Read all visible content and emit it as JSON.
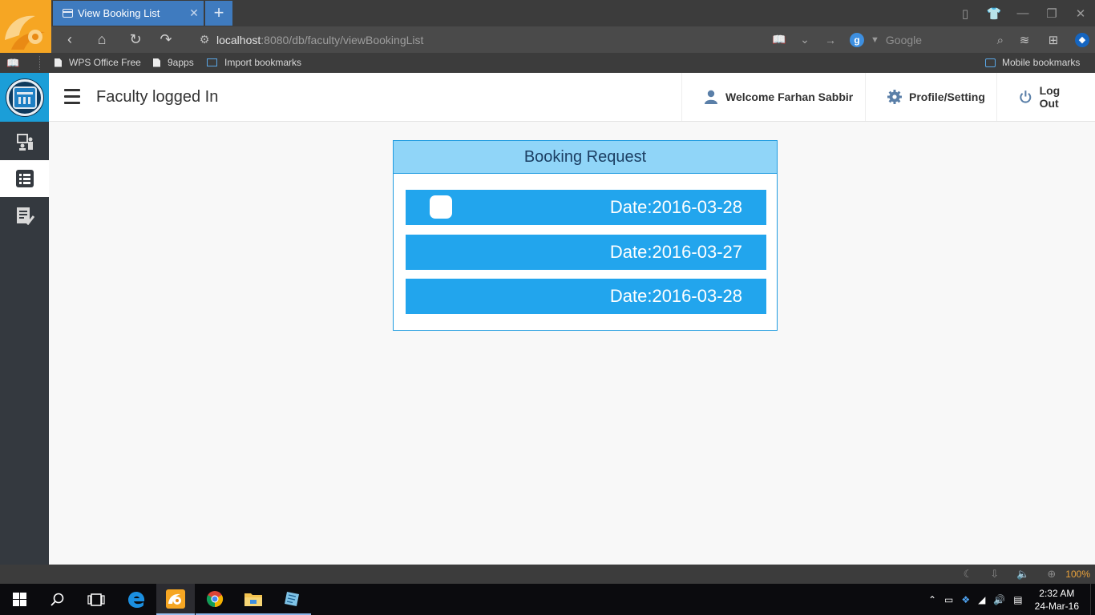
{
  "browser": {
    "tab_title": "View Booking List",
    "tab_close": "✕",
    "new_tab": "+",
    "url_host": "localhost",
    "url_path": ":8080/db/faculty/viewBookingList",
    "search_engine_badge": "g",
    "search_placeholder": "Google",
    "zoom": "100%"
  },
  "bookmarks": [
    {
      "label": "WPS Office Free",
      "icon": "document-icon"
    },
    {
      "label": "9apps",
      "icon": "document-icon"
    },
    {
      "label": "Import bookmarks",
      "icon": "import-icon"
    }
  ],
  "mobile_bookmarks": "Mobile bookmarks",
  "app": {
    "title": "Faculty logged In",
    "welcome": "Welcome Farhan Sabbir",
    "profile": "Profile/Setting",
    "logout": "Log Out",
    "accent": "#22a5ed",
    "header_bg": "#90d5f8"
  },
  "booking": {
    "heading": "Booking Request",
    "rows": [
      {
        "date": "Date:2016-03-28"
      },
      {
        "date": "Date:2016-03-27"
      },
      {
        "date": "Date:2016-03-28"
      }
    ]
  },
  "taskbar": {
    "time": "2:32 AM",
    "date": "24-Mar-16"
  }
}
